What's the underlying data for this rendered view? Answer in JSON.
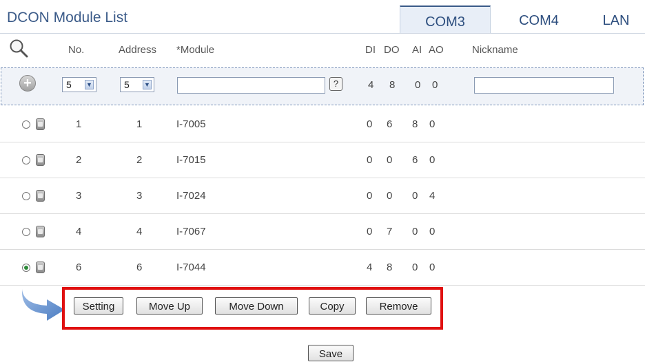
{
  "page": {
    "title": "DCON Module List"
  },
  "tabs": [
    {
      "label": "COM3",
      "active": true
    },
    {
      "label": "COM4",
      "active": false
    },
    {
      "label": "LAN",
      "active": false
    }
  ],
  "columns": {
    "search_icon": "magnifier-icon",
    "no": "No.",
    "address": "Address",
    "module": "*Module",
    "di": "DI",
    "do": "DO",
    "ai": "AI",
    "ao": "AO",
    "nickname": "Nickname"
  },
  "add_row": {
    "no_value": "5",
    "address_value": "5",
    "module_value": "",
    "help_label": "?",
    "di": "4",
    "do": "8",
    "ai": "0",
    "ao": "0",
    "nickname_value": ""
  },
  "modules": [
    {
      "no": "1",
      "address": "1",
      "module": "I-7005",
      "di": "0",
      "do": "6",
      "ai": "8",
      "ao": "0",
      "selected": false
    },
    {
      "no": "2",
      "address": "2",
      "module": "I-7015",
      "di": "0",
      "do": "0",
      "ai": "6",
      "ao": "0",
      "selected": false
    },
    {
      "no": "3",
      "address": "3",
      "module": "I-7024",
      "di": "0",
      "do": "0",
      "ai": "0",
      "ao": "4",
      "selected": false
    },
    {
      "no": "4",
      "address": "4",
      "module": "I-7067",
      "di": "0",
      "do": "7",
      "ai": "0",
      "ao": "0",
      "selected": false
    },
    {
      "no": "6",
      "address": "6",
      "module": "I-7044",
      "di": "4",
      "do": "8",
      "ai": "0",
      "ao": "0",
      "selected": true
    }
  ],
  "actions": {
    "setting": "Setting",
    "move_up": "Move Up",
    "move_down": "Move Down",
    "copy": "Copy",
    "remove": "Remove",
    "save": "Save"
  },
  "colors": {
    "accent": "#3a5a88",
    "highlight_border": "#e01010",
    "selected_radio": "#2d8a3a"
  }
}
